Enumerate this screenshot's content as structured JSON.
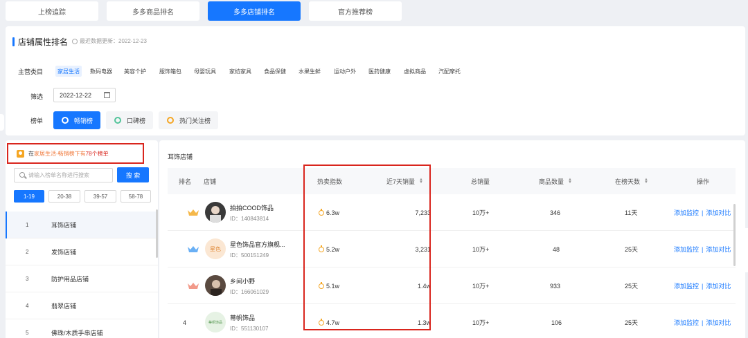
{
  "top_tabs": [
    {
      "label": "上榜追踪"
    },
    {
      "label": "多多商品排名"
    },
    {
      "label": "多多店铺排名"
    },
    {
      "label": "官方推荐榜"
    }
  ],
  "filter": {
    "title": "店铺属性排名",
    "update_text": "最近数据更新：2022-12-23",
    "category_label": "主营类目",
    "categories": [
      "家居生活",
      "数码电器",
      "美容个护",
      "服饰箱包",
      "母婴玩具",
      "家纺家具",
      "食品保健",
      "水果生鲜",
      "运动户外",
      "医药健康",
      "虚拟商品",
      "汽配摩托"
    ],
    "filter_label": "筛选",
    "date_value": "2022-12-22",
    "rank_label": "榜单",
    "rank_buttons": [
      "畅销榜",
      "口碑榜",
      "热门关注榜"
    ]
  },
  "left": {
    "result": {
      "prefix": "在",
      "category": "家居生活",
      "mid": "-畅销榜下有",
      "count": "78个榜单"
    },
    "search_placeholder": "请输入榜单名称进行搜索",
    "search_button": "搜 索",
    "pages": [
      "1-19",
      "20-38",
      "39-57",
      "58-78"
    ],
    "items": [
      {
        "num": "1",
        "name": "耳饰店铺"
      },
      {
        "num": "2",
        "name": "发饰店铺"
      },
      {
        "num": "3",
        "name": "防护用品店铺"
      },
      {
        "num": "4",
        "name": "翡翠店铺"
      },
      {
        "num": "5",
        "name": "佛珠/木质手串店铺"
      }
    ]
  },
  "table": {
    "section_name": "耳饰店铺",
    "headers": {
      "rank": "排名",
      "shop": "店铺",
      "hot": "热卖指数",
      "sales7": "近7天销量",
      "total": "总销量",
      "products": "商品数量",
      "days": "在榜天数",
      "ops": "操作"
    },
    "rows": [
      {
        "rank": "",
        "crown_color": "#f5b84a",
        "name": "拍拍COOD饰品",
        "id": "ID：140843814",
        "hot": "6.3w",
        "sales7": "7,233",
        "total": "10万+",
        "products": "346",
        "days": "11天",
        "avatar_bg": "#3a3a3a"
      },
      {
        "rank": "",
        "crown_color": "#6ab0f5",
        "name": "星色饰品官方旗舰...",
        "id": "ID：500151249",
        "hot": "5.2w",
        "sales7": "3,231",
        "total": "10万+",
        "products": "48",
        "days": "25天",
        "avatar_bg": "#fbe7d3",
        "avatar_text": "星色"
      },
      {
        "rank": "",
        "crown_color": "#f29a8a",
        "name": "乡间小野",
        "id": "ID：166061029",
        "hot": "5.1w",
        "sales7": "1.4w",
        "total": "10万+",
        "products": "933",
        "days": "25天",
        "avatar_bg": "#5a4a40"
      },
      {
        "rank": "4",
        "crown_color": "",
        "name": "蒂帆饰品",
        "id": "ID：551130107",
        "hot": "4.7w",
        "sales7": "1.3w",
        "total": "10万+",
        "products": "106",
        "days": "25天",
        "avatar_bg": "#e6f2e4",
        "avatar_text": "蒂帆饰品"
      }
    ],
    "op_monitor": "添加监控",
    "op_sep": "|",
    "op_compare": "添加对比"
  }
}
